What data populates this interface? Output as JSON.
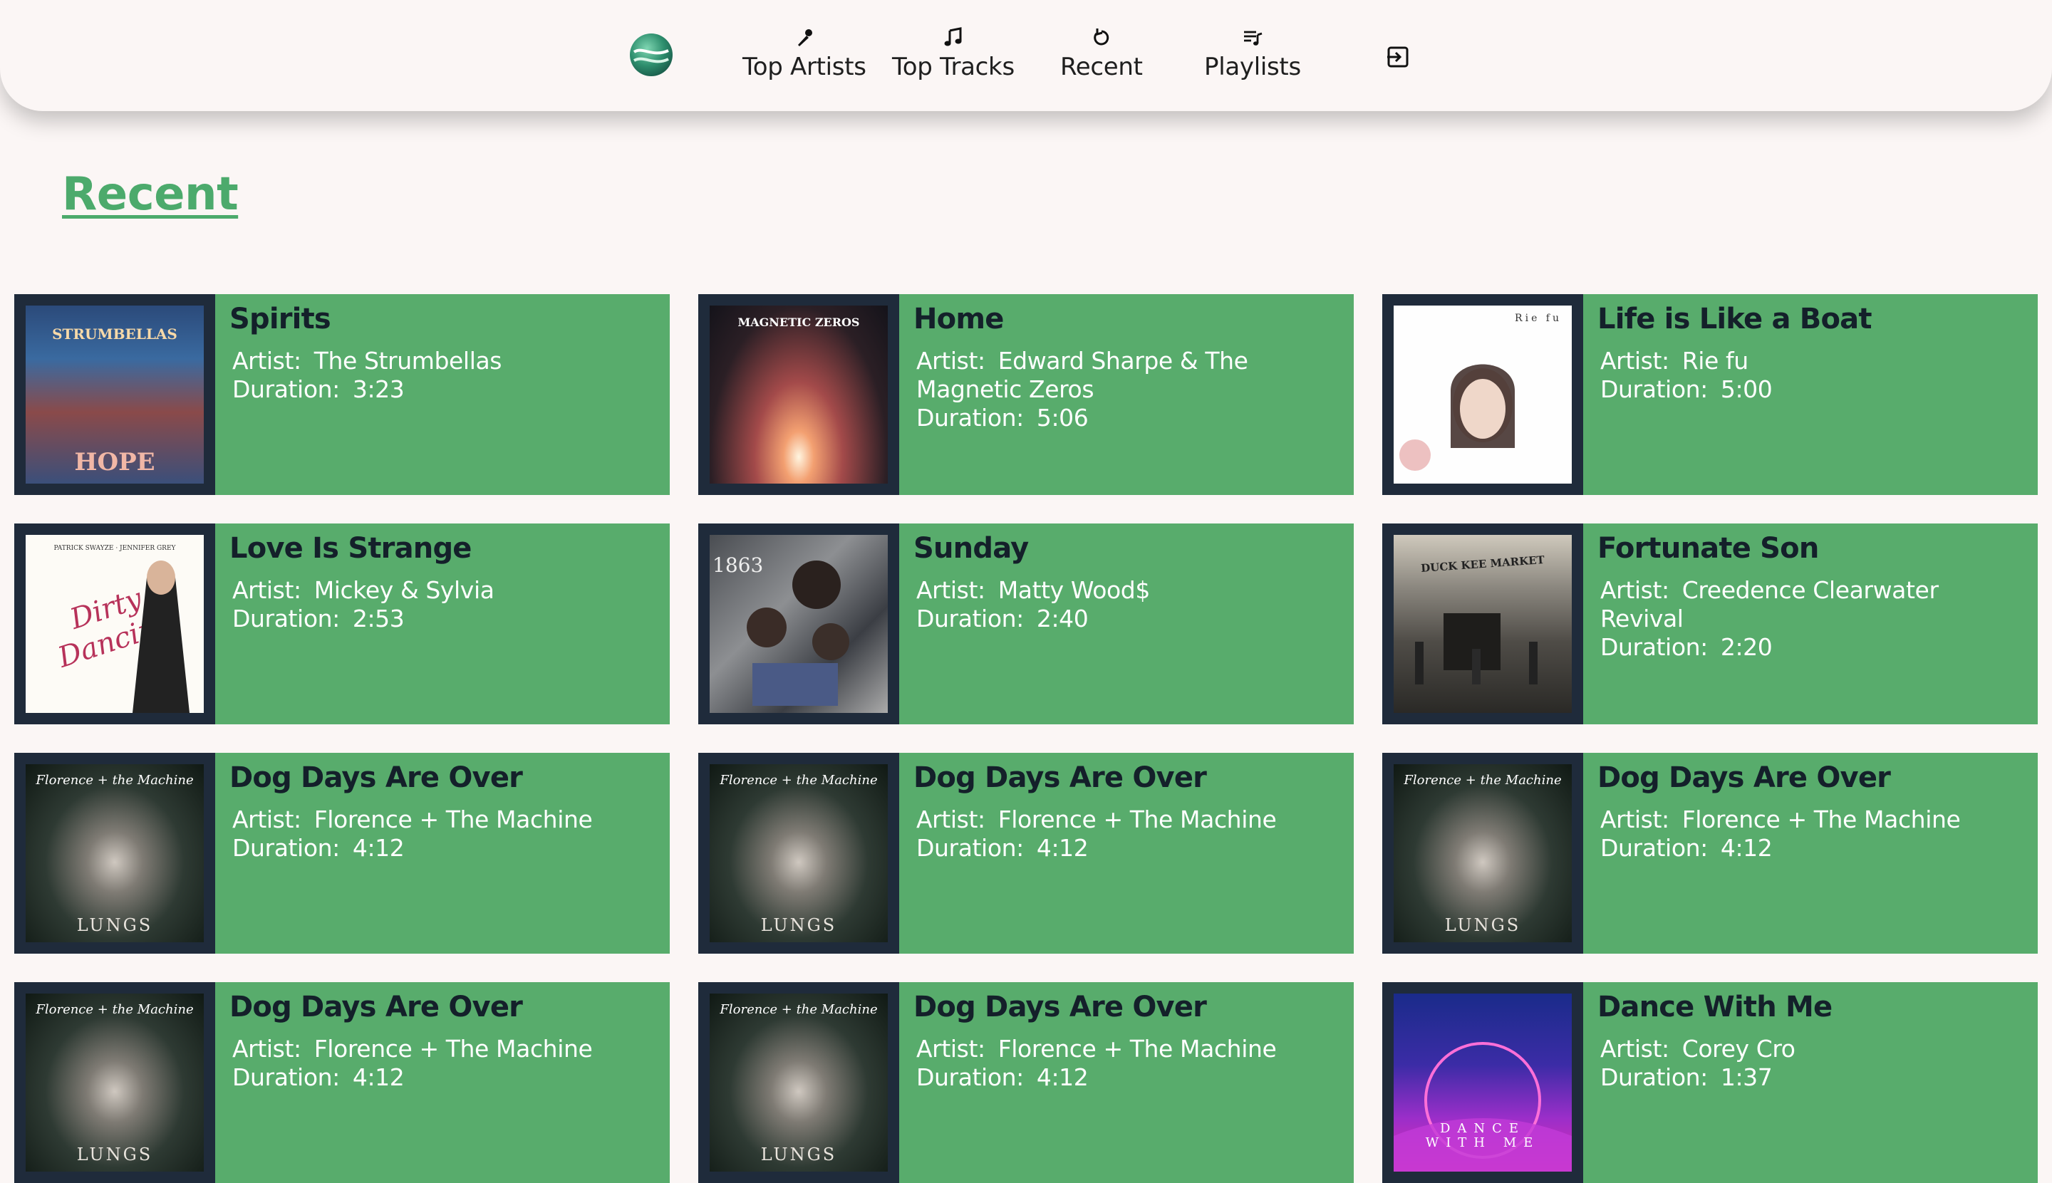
{
  "nav": {
    "items": [
      {
        "label": "Top Artists",
        "icon": "microphone-icon"
      },
      {
        "label": "Top Tracks",
        "icon": "music-note-icon"
      },
      {
        "label": "Recent",
        "icon": "history-icon"
      },
      {
        "label": "Playlists",
        "icon": "playlist-icon"
      }
    ],
    "logout_icon": "logout-icon"
  },
  "page": {
    "title": "Recent"
  },
  "labels": {
    "artist": "Artist:",
    "duration": "Duration:"
  },
  "tracks": [
    {
      "title": "Spirits",
      "artist": "The Strumbellas",
      "duration": "3:23",
      "art_text": "STRUMBELLAS",
      "art_sub": "HOPE"
    },
    {
      "title": "Home",
      "artist": "Edward Sharpe & The Magnetic Zeros",
      "duration": "5:06",
      "art_text": "MAGNETIC ZEROS"
    },
    {
      "title": "Life is Like a Boat",
      "artist": "Rie fu",
      "duration": "5:00",
      "art_text": "Rie fu"
    },
    {
      "title": "Love Is Strange",
      "artist": "Mickey & Sylvia",
      "duration": "2:53",
      "art_text": "Dirty Dancing",
      "art_sub": "PATRICK SWAYZE · JENNIFER GREY"
    },
    {
      "title": "Sunday",
      "artist": "Matty Wood$",
      "duration": "2:40",
      "art_text": "1863"
    },
    {
      "title": "Fortunate Son",
      "artist": "Creedence Clearwater Revival",
      "duration": "2:20",
      "art_text": "DUCK KEE MARKET"
    },
    {
      "title": "Dog Days Are Over",
      "artist": "Florence + The Machine",
      "duration": "4:12",
      "art_text": "Florence + the Machine",
      "art_sub": "LUNGS"
    },
    {
      "title": "Dog Days Are Over",
      "artist": "Florence + The Machine",
      "duration": "4:12",
      "art_text": "Florence + the Machine",
      "art_sub": "LUNGS"
    },
    {
      "title": "Dog Days Are Over",
      "artist": "Florence + The Machine",
      "duration": "4:12",
      "art_text": "Florence + the Machine",
      "art_sub": "LUNGS"
    },
    {
      "title": "Dog Days Are Over",
      "artist": "Florence + The Machine",
      "duration": "4:12",
      "art_text": "Florence + the Machine",
      "art_sub": "LUNGS"
    },
    {
      "title": "Dog Days Are Over",
      "artist": "Florence + The Machine",
      "duration": "4:12",
      "art_text": "Florence + the Machine",
      "art_sub": "LUNGS"
    },
    {
      "title": "Dance With Me",
      "artist": "Corey Cro",
      "duration": "1:37",
      "art_text": "DANCE WITH ME"
    }
  ]
}
